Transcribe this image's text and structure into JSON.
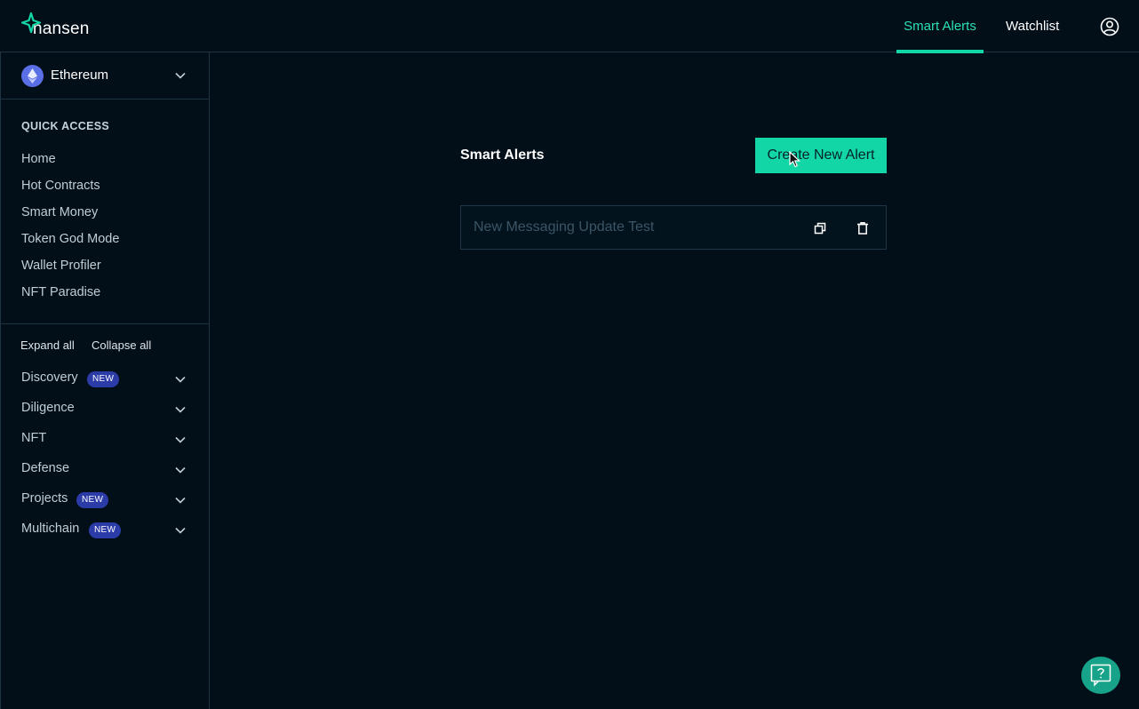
{
  "header": {
    "logo_text": "nansen",
    "tabs": [
      {
        "label": "Smart Alerts",
        "active": true
      },
      {
        "label": "Watchlist",
        "active": false
      }
    ]
  },
  "sidebar": {
    "chain": {
      "label": "Ethereum"
    },
    "quick_access_title": "QUICK ACCESS",
    "quick_access": [
      "Home",
      "Hot Contracts",
      "Smart Money",
      "Token God Mode",
      "Wallet Profiler",
      "NFT Paradise"
    ],
    "expand_all": "Expand all",
    "collapse_all": "Collapse all",
    "groups": [
      {
        "label": "Discovery",
        "badge": "NEW"
      },
      {
        "label": "Diligence",
        "badge": ""
      },
      {
        "label": "NFT",
        "badge": ""
      },
      {
        "label": "Defense",
        "badge": ""
      },
      {
        "label": "Projects",
        "badge": "NEW"
      },
      {
        "label": "Multichain",
        "badge": "NEW"
      }
    ]
  },
  "main": {
    "title": "Smart Alerts",
    "create_button": "Create New Alert",
    "alerts": [
      {
        "name": "New Messaging Update Test"
      }
    ]
  },
  "colors": {
    "background": "#020f18",
    "accent": "#12d6a6",
    "active_tab": "#2be0b5",
    "badge": "#2b3ca8",
    "border": "#1e3442"
  }
}
